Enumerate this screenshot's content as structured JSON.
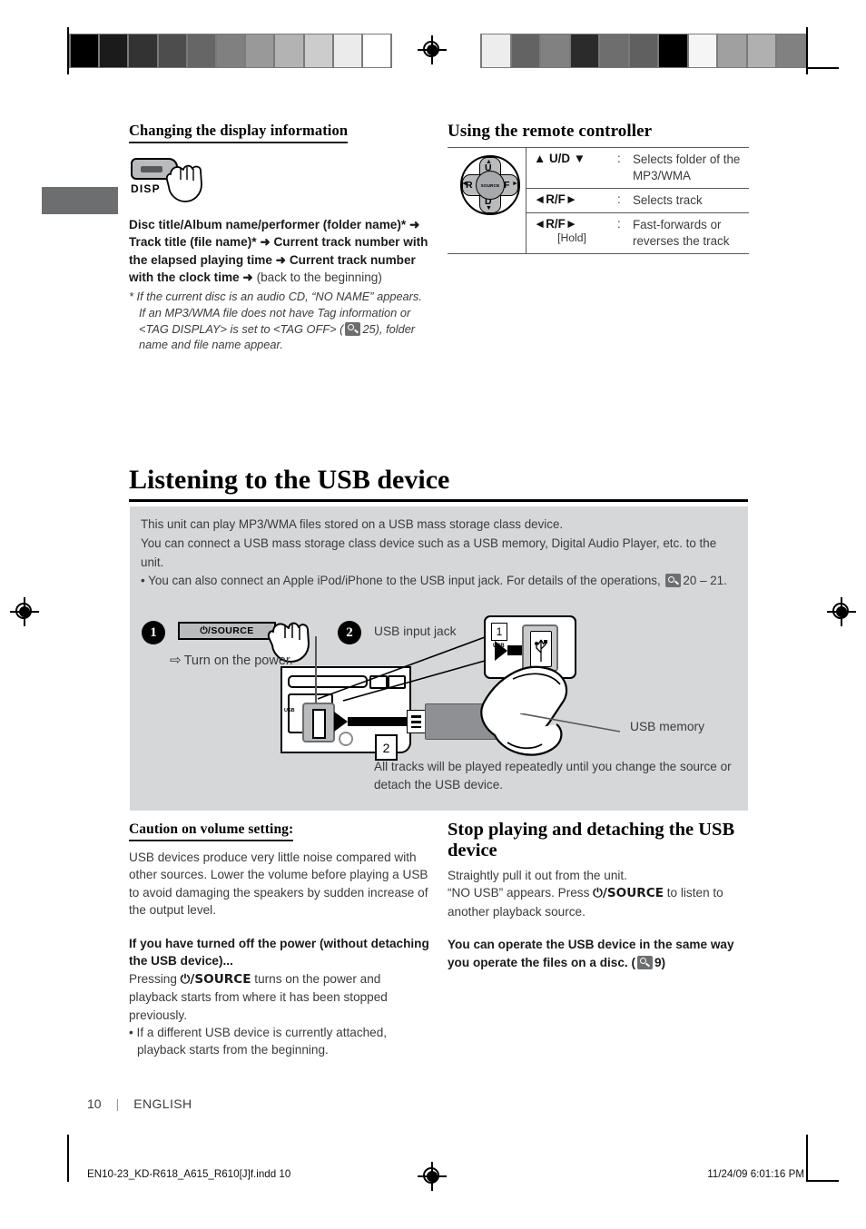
{
  "calibration": {
    "left_strip": [
      "#000000",
      "#1b1b1b",
      "#333333",
      "#4d4d4d",
      "#666666",
      "#808080",
      "#999999",
      "#b3b3b3",
      "#cccccc",
      "#ebebeb",
      "#ffffff"
    ],
    "right_strip": [
      "#ededed",
      "#636363",
      "#818181",
      "#2b2b2b",
      "#6e6e6e",
      "#606060",
      "#000000",
      "#f5f5f5",
      "#a0a0a0",
      "#b0b0b0",
      "#818181"
    ]
  },
  "left_column": {
    "heading": "Changing the display information",
    "disp_button": {
      "label": "DISP",
      "icon": "disp-key-icon"
    },
    "sequence_bold_1": "Disc title/Album name/performer (folder name)*",
    "arrow": "➜",
    "sequence_bold_2": "Track title (file name)*",
    "sequence_bold_3": "Current track number with the elapsed playing time",
    "sequence_bold_4": "Current track number with the clock time",
    "sequence_tail": "(back to the beginning)",
    "footnote_1": "* If the current disc is an audio CD, “NO NAME” appears.",
    "footnote_2a": "If an MP3/WMA file does not have Tag information or <TAG DISPLAY> is set to <TAG OFF> (",
    "footnote_2_page": "25),",
    "footnote_2b": "folder name and file name appear."
  },
  "right_column": {
    "heading": "Using the remote controller",
    "pad_icon": {
      "up": "U",
      "down": "D",
      "left": "R",
      "right": "F",
      "center": "SOURCE"
    },
    "rows": [
      {
        "key": "▲ U/D ▼",
        "hold": "",
        "colon": ":",
        "desc": "Selects folder of the MP3/WMA"
      },
      {
        "key": "◄R/F►",
        "hold": "",
        "colon": ":",
        "desc": "Selects track"
      },
      {
        "key": "◄R/F►",
        "hold": "[Hold]",
        "colon": ":",
        "desc": "Fast-forwards or reverses the track"
      }
    ]
  },
  "section": {
    "title": "Listening to the USB device",
    "intro_line1": "This unit can play MP3/WMA files stored on a USB mass storage class device.",
    "intro_line2": "You can connect a USB mass storage class device such as a USB memory, Digital Audio Player, etc. to the unit.",
    "intro_bullet": "• You can also connect an Apple iPod/iPhone to the USB input jack. For details of the operations,",
    "intro_bullet_page": "20 – 21.",
    "step1": {
      "number": "1",
      "key_label": "⏻/SOURCE",
      "arrow": "⇨",
      "text": "Turn on the power."
    },
    "step2": {
      "number": "2",
      "jack_label": "USB input jack",
      "memory_label": "USB memory",
      "callout_number": "1",
      "callout_usb_text": "USB",
      "inline_number": "2",
      "unit_usb_text": "USB",
      "footer": "All tracks will be played repeatedly until you change the source or detach the USB device."
    }
  },
  "bottom_left": {
    "caution_heading": "Caution on volume setting:",
    "caution_body": "USB devices produce very little noise compared with other sources. Lower the volume before playing a USB to avoid damaging the speakers by sudden increase of the output level.",
    "power_heading": "If you have turned off the power (without detaching the USB device)...",
    "power_body_1": "Pressing ",
    "power_body_key": "⏻/SOURCE",
    "power_body_2": " turns on the power and playback starts from where it has been stopped previously.",
    "power_bullet": "• If a different USB device is currently attached, playback starts from the beginning."
  },
  "bottom_right": {
    "stop_heading": "Stop playing and detaching the USB device",
    "stop_body_1": "Straightly pull it out from the unit.",
    "stop_body_2a": "“NO USB” appears. Press ",
    "stop_body_key": "⏻/SOURCE",
    "stop_body_2b": " to listen to another playback source.",
    "operate_note_a": "You can operate the USB device in the same way you operate the files on a disc.  (",
    "operate_note_page": "9)"
  },
  "footer": {
    "page_number": "10",
    "separator": "|",
    "language": "ENGLISH",
    "file_name": "EN10-23_KD-R618_A615_R610[J]f.indd   10",
    "timestamp": "11/24/09   6:01:16 PM"
  }
}
